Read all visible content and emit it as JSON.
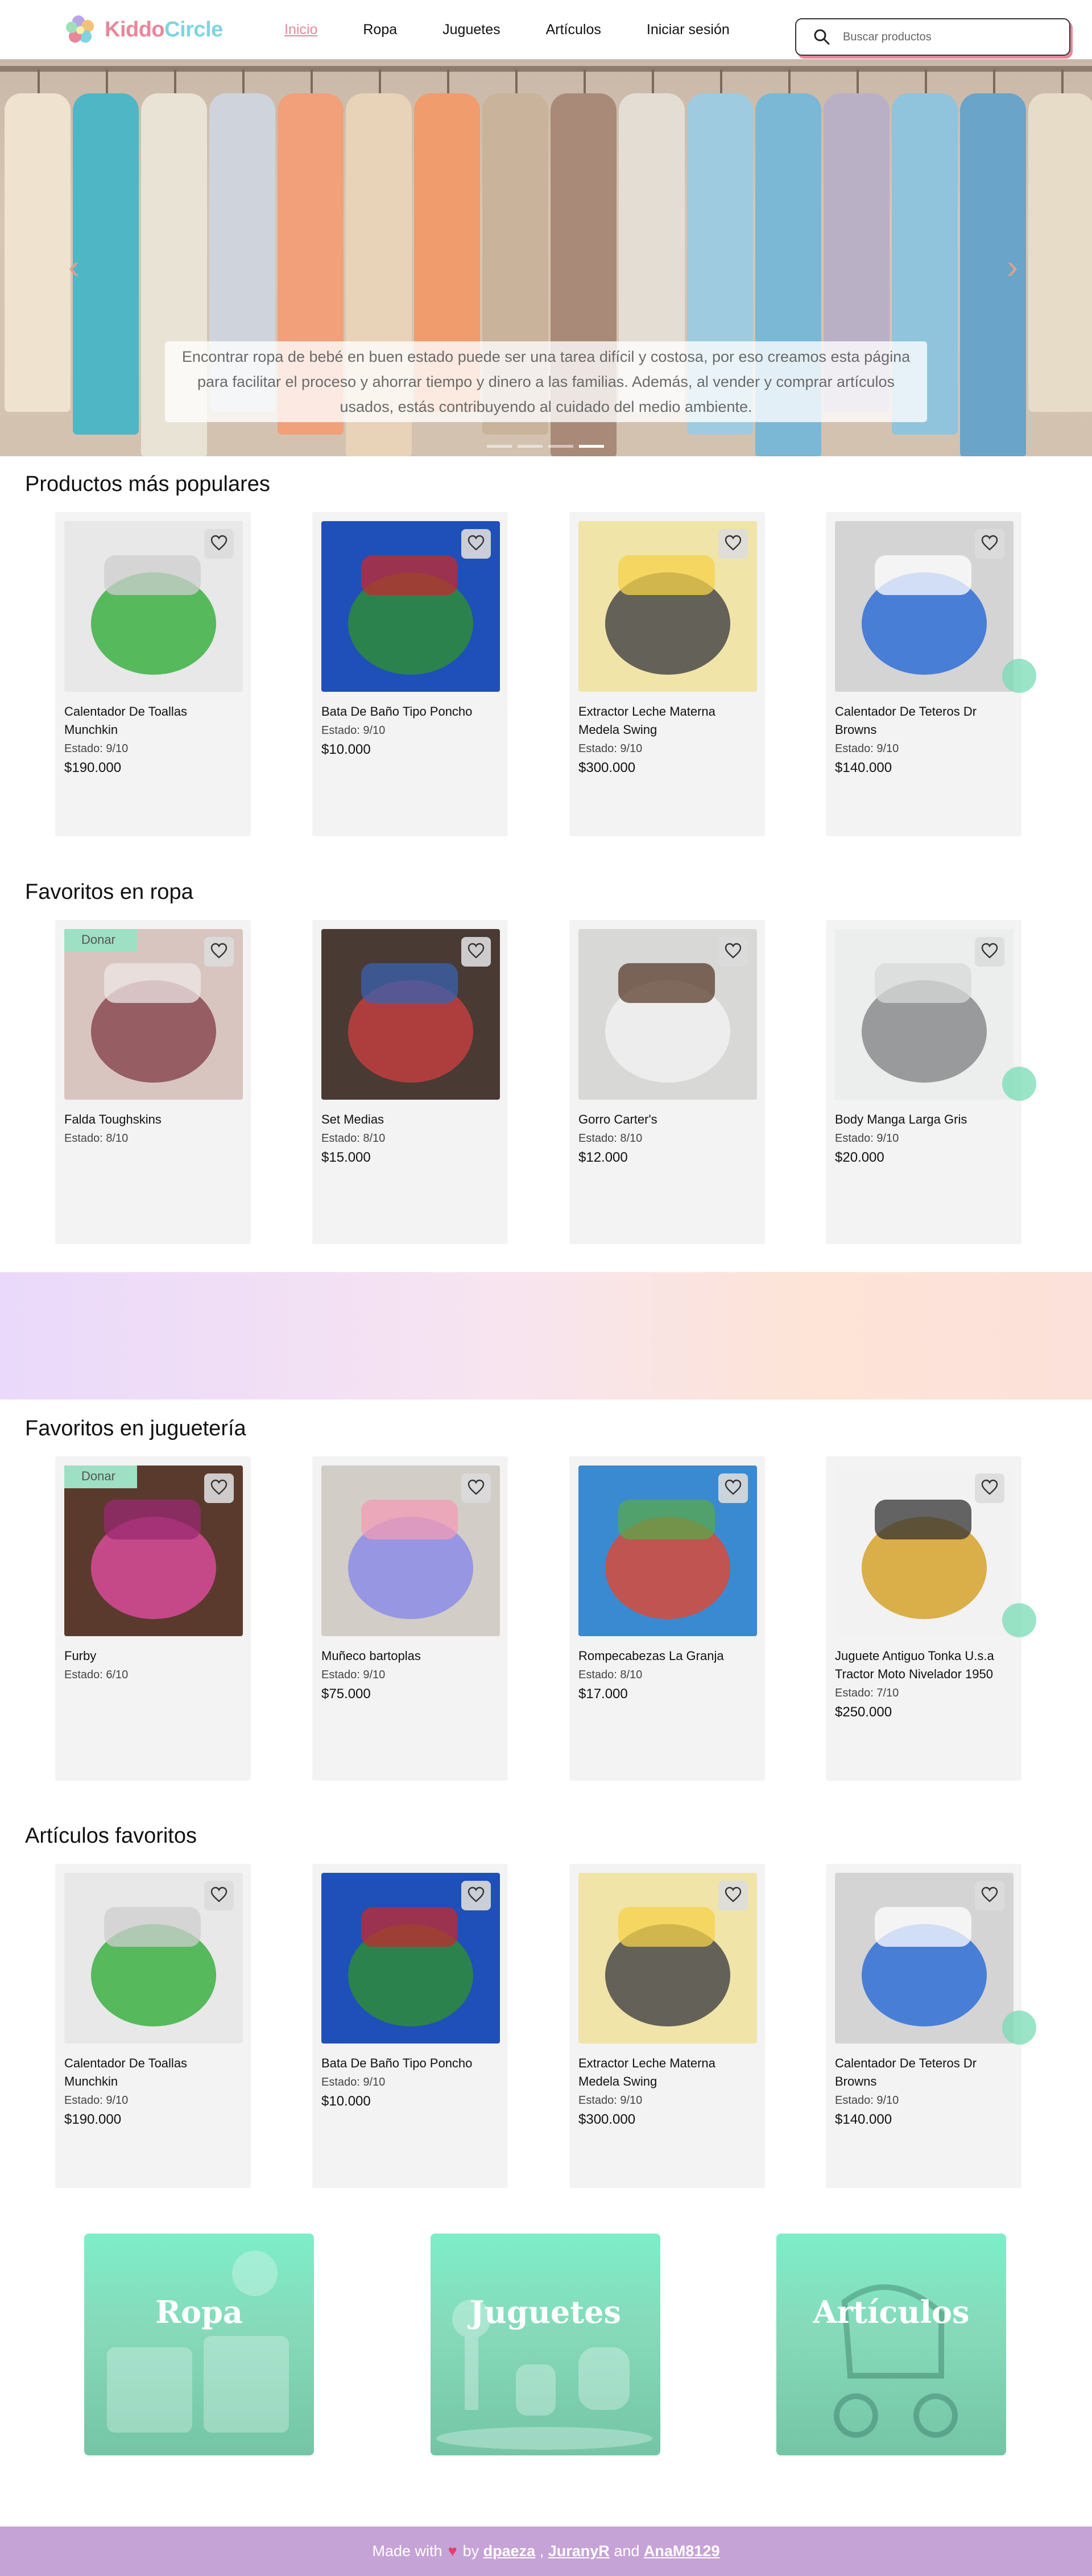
{
  "nav": {
    "logo": {
      "part1": "Kiddo",
      "part2": "Circle"
    },
    "links": [
      "Inicio",
      "Ropa",
      "Juguetes",
      "Artículos",
      "Iniciar sesión"
    ],
    "search_placeholder": "Buscar productos"
  },
  "hero": {
    "caption": "Encontrar ropa de bebé en buen estado puede ser una tarea difícil y costosa, por eso creamos esta página para facilitar el proceso y ahorrar tiempo y dinero a las familias. Además, al vender y comprar artículos usados, estás contribuyendo al cuidado del medio ambiente.",
    "prev_icon": "‹",
    "next_icon": "›",
    "slides_count": 4,
    "active_slide": 4
  },
  "sections": [
    {
      "title": "Productos más populares",
      "cards": [
        {
          "name": "Calentador De Toallas Munchkin",
          "state": "Estado: 9/10",
          "price": "$190.000",
          "donar": false
        },
        {
          "name": "Bata De Baño Tipo Poncho",
          "state": "Estado: 9/10",
          "price": "$10.000",
          "donar": false
        },
        {
          "name": "Extractor Leche Materna Medela Swing",
          "state": "Estado: 9/10",
          "price": "$300.000",
          "donar": false
        },
        {
          "name": "Calentador De Teteros Dr Browns",
          "state": "Estado: 9/10",
          "price": "$140.000",
          "donar": false
        }
      ]
    },
    {
      "title": "Favoritos en ropa",
      "cards": [
        {
          "name": "Falda Toughskins",
          "state": "Estado: 8/10",
          "price": "",
          "donar": true
        },
        {
          "name": "Set Medias",
          "state": "Estado: 8/10",
          "price": "$15.000",
          "donar": false
        },
        {
          "name": "Gorro Carter's",
          "state": "Estado: 8/10",
          "price": "$12.000",
          "donar": false
        },
        {
          "name": "Body Manga Larga Gris",
          "state": "Estado: 9/10",
          "price": "$20.000",
          "donar": false
        }
      ]
    },
    {
      "title": "Favoritos en juguetería",
      "cards": [
        {
          "name": "Furby",
          "state": "Estado: 6/10",
          "price": "",
          "donar": true
        },
        {
          "name": "Muñeco bartoplas",
          "state": "Estado: 9/10",
          "price": "$75.000",
          "donar": false
        },
        {
          "name": "Rompecabezas La Granja",
          "state": "Estado: 8/10",
          "price": "$17.000",
          "donar": false
        },
        {
          "name": "Juguete Antiguo Tonka U.s.a Tractor Moto Nivelador 1950",
          "state": "Estado: 7/10",
          "price": "$250.000",
          "donar": false
        }
      ]
    },
    {
      "title": "Artículos favoritos",
      "cards": [
        {
          "name": "Calentador De Toallas Munchkin",
          "state": "Estado: 9/10",
          "price": "$190.000",
          "donar": false
        },
        {
          "name": "Bata De Baño Tipo Poncho",
          "state": "Estado: 9/10",
          "price": "$10.000",
          "donar": false
        },
        {
          "name": "Extractor Leche Materna Medela Swing",
          "state": "Estado: 9/10",
          "price": "$300.000",
          "donar": false
        },
        {
          "name": "Calentador De Teteros Dr Browns",
          "state": "Estado: 9/10",
          "price": "$140.000",
          "donar": false
        }
      ]
    }
  ],
  "donar_label": "Donar",
  "categories": [
    "Ropa",
    "Juguetes",
    "Artículos"
  ],
  "footer": {
    "made_with": "Made with",
    "heart": "♥",
    "by": "by",
    "authors": [
      "dpaeza",
      "JuranyR",
      "AnaM8129"
    ],
    "sep1": ",",
    "and": "and"
  },
  "colors": {
    "brand_pink": "#e8879a",
    "brand_teal": "#7fd4e0",
    "card_bg": "#f3f3f3",
    "donar_badge": "#9ee0c4",
    "category_tile": "#7deec9",
    "footer_bg": "#c6a3d6"
  },
  "icons": {
    "search": "search-icon",
    "favorite": "heart-outline-icon",
    "chat": "chat-bubble-icon"
  }
}
